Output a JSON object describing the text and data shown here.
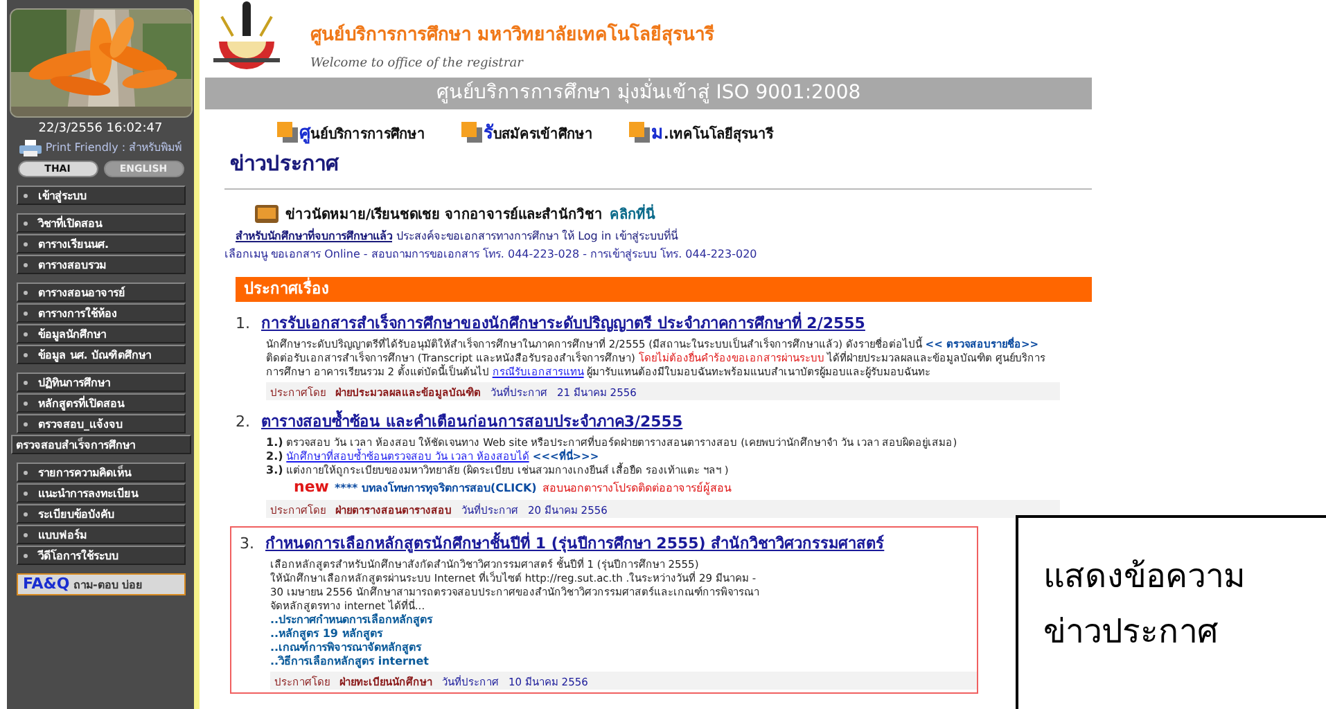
{
  "sidebar": {
    "date": "22/3/2556 16:02:47",
    "print_label": "Print Friendly : สำหรับพิมพ์",
    "languages": [
      {
        "label": "THAI",
        "selected": true
      },
      {
        "label": "ENGLISH",
        "selected": false
      }
    ],
    "menu_groups": [
      [
        {
          "label": "เข้าสู่ระบบ",
          "kind": "bullet"
        }
      ],
      [
        {
          "label": "วิชาที่เปิดสอน",
          "kind": "bullet"
        },
        {
          "label": "ตารางเรียนนศ.",
          "kind": "bullet"
        },
        {
          "label": "ตารางสอบรวม",
          "kind": "bullet"
        }
      ],
      [
        {
          "label": "ตารางสอนอาจารย์",
          "kind": "bullet"
        },
        {
          "label": "ตารางการใช้ห้อง",
          "kind": "bullet"
        },
        {
          "label": "ข้อมูลนักศึกษา",
          "kind": "bullet"
        },
        {
          "label": "ข้อมูล นศ. บัณฑิตศึกษา",
          "kind": "bullet"
        }
      ],
      [
        {
          "label": "ปฏิทินการศึกษา",
          "kind": "bullet"
        },
        {
          "label": "หลักสูตรที่เปิดสอน",
          "kind": "bullet"
        },
        {
          "label": "ตรวจสอบ_แจ้งจบ",
          "kind": "bullet"
        },
        {
          "label": "ตรวจสอบสำเร็จการศึกษา",
          "kind": "wide"
        }
      ],
      [
        {
          "label": "รายการความคิดเห็น",
          "kind": "bullet"
        },
        {
          "label": "แนะนำการลงทะเบียน",
          "kind": "bullet"
        },
        {
          "label": "ระเบียบข้อบังคับ",
          "kind": "bullet"
        },
        {
          "label": "แบบฟอร์ม",
          "kind": "bullet"
        },
        {
          "label": "วีดีโอการใช้ระบบ",
          "kind": "bullet"
        }
      ]
    ],
    "faq": {
      "mark": "FA&Q",
      "text": "ถาม-ตอบ บ่อย"
    }
  },
  "header": {
    "subtitle": "ศูนย์บริการการศึกษา  มหาวิทยาลัยเทคโนโลยีสุรนารี",
    "welcome": "Welcome to office of the registrar",
    "banner": "ศูนย์บริการการศึกษา มุ่งมั่นเข้าสู่ ISO 9001:2008"
  },
  "top_links": [
    {
      "initial": "ศู",
      "rest": "นย์บริการการศึกษา"
    },
    {
      "initial": "รั",
      "rest": "บสมัครเข้าศึกษา"
    },
    {
      "initial": "ม",
      "rest": ".เทคโนโลยีสุรนารี"
    }
  ],
  "page_heading": "ข่าวประกาศ",
  "notice": {
    "text": "ข่าวนัดหมาย/เรียนชดเชย จากอาจารย์และสำนักวิชา",
    "link": "คลิกที่นี่"
  },
  "graduate_line": {
    "link": "สำหรับนักศึกษาที่จบการศึกษาแล้ว",
    "text": "ประสงค์จะขอเอกสารทางการศึกษา ให้ Log in เข้าสู่ระบบที่นี่"
  },
  "contact_line": "เลือกเมนู ขอเอกสาร Online - สอบถามการขอเอกสาร โทร. 044-223-028 - การเข้าสู่ระบบ โทร. 044-223-020",
  "announcements_header": "ประกาศเรื่อง",
  "announcements": [
    {
      "number": "1.",
      "title": "การรับเอกสารสำเร็จการศึกษาของนักศึกษาระดับปริญญาตรี ประจำภาคการศึกษาที่ 2/2555",
      "highlighted": false,
      "blocks": [
        {
          "kind": "para",
          "segments": [
            {
              "kind": "text",
              "text": "นักศึกษาระดับปริญญาตรีที่ได้รับอนุมัติให้สำเร็จการศึกษาในภาคการศึกษาที่ 2/2555 (มีสถานะในระบบเป็นสำเร็จการศึกษาแล้ว) ดังรายชื่อต่อไปนี้ "
            },
            {
              "kind": "strong-link",
              "text": "<< ตรวจสอบรายชื่อ>>"
            },
            {
              "kind": "text",
              "text": " ติดต่อรับเอกสารสำเร็จการศึกษา (Transcript และหนังสือรับรองสำเร็จการศึกษา) "
            },
            {
              "kind": "alert",
              "text": "โดยไม่ต้องยื่นคำร้องขอเอกสารผ่านระบบ"
            },
            {
              "kind": "text",
              "text": " ได้ที่ฝ่ายประมวลผลและข้อมูลบัณฑิต ศูนย์บริการการศึกษา อาคารเรียนรวม 2 ตั้งแต่บัดนี้เป็นต้นไป "
            },
            {
              "kind": "link",
              "text": "กรณีรับเอกสารแทน"
            },
            {
              "kind": "text",
              "text": " ผู้มารับแทนต้องมีใบมอบฉันทะพร้อมแนบสำเนาบัตรผู้มอบและผู้รับมอบฉันทะ"
            }
          ]
        }
      ],
      "posted_label": "ประกาศโดย",
      "posted_by": "ฝ่ายประมวลผลและข้อมูลบัณฑิต",
      "date_label": "วันที่ประกาศ",
      "date": "21 มีนาคม 2556"
    },
    {
      "number": "2.",
      "title": "ตารางสอบซ้ำซ้อน และคำเตือนก่อนการสอบประจำภาค3/2555",
      "highlighted": false,
      "blocks": [
        {
          "kind": "item",
          "num": "1.)",
          "segments": [
            {
              "kind": "text",
              "text": "ตรวจสอบ วัน เวลา ห้องสอบ ให้ชัดเจนทาง Web site หรือประกาศที่บอร์ดฝ่ายตารางสอนตารางสอบ (เคยพบว่านักศึกษาจำ วัน เวลา สอบผิดอยู่เสมอ)"
            }
          ]
        },
        {
          "kind": "item",
          "num": "2.)",
          "segments": [
            {
              "kind": "link",
              "text": "นักศึกษาที่สอบซ้ำซ้อนตรวจสอบ วัน เวลา ห้องสอบได้"
            },
            {
              "kind": "strong-link",
              "text": " <<<ที่นี่>>>"
            }
          ]
        },
        {
          "kind": "item",
          "num": "3.)",
          "segments": [
            {
              "kind": "text",
              "text": "แต่งกายให้ถูกระเบียบของมหาวิทยาลัย (ผิดระเบียบ เช่นสวมกางเกงยีนส์ เสื้อยืด รองเท้าแตะ ฯลฯ )"
            }
          ]
        },
        {
          "kind": "new",
          "badge": "new",
          "segments": [
            {
              "kind": "strong-link",
              "text": "**** บทลงโทษการทุจริตการสอบ(CLICK)"
            },
            {
              "kind": "alert",
              "text": " สอบนอกตารางโปรดติดต่ออาจารย์ผู้สอน"
            }
          ]
        }
      ],
      "posted_label": "ประกาศโดย",
      "posted_by": "ฝ่ายตารางสอนตารางสอบ",
      "date_label": "วันที่ประกาศ",
      "date": "20 มีนาคม 2556"
    },
    {
      "number": "3.",
      "title": "กำหนดการเลือกหลักสูตรนักศึกษาชั้นปีที่ 1 (รุ่นปีการศึกษา 2555) สำนักวิชาวิศวกรรมศาสตร์",
      "highlighted": true,
      "blocks": [
        {
          "kind": "line",
          "text": "เลือกหลักสูตรสำหรับนักศึกษาสังกัดสำนักวิชาวิศวกรรมศาสตร์ ชั้นปีที่ 1 (รุ่นปีการศึกษา 2555)"
        },
        {
          "kind": "line",
          "text": "ให้นักศึกษาเลือกหลักสูตรผ่านระบบ Internet ที่เว็บไซต์ http://reg.sut.ac.th .ในระหว่างวันที่ 29 มีนาคม -"
        },
        {
          "kind": "line",
          "text": "30 เมษายน 2556 นักศึกษาสามารถตรวจสอบประกาศของสำนักวิชาวิศวกรรมศาสตร์และเกณฑ์การพิจารณา"
        },
        {
          "kind": "line",
          "text": "จัดหลักสูตรทาง internet ได้ที่นี่..."
        },
        {
          "kind": "link",
          "text": "..ประกาศกำหนดการเลือกหลักสูตร"
        },
        {
          "kind": "link",
          "text": "..หลักสูตร 19 หลักสูตร"
        },
        {
          "kind": "link",
          "text": "..เกณฑ์การพิจารณาจัดหลักสูตร"
        },
        {
          "kind": "link",
          "text": "..วิธีการเลือกหลักสูตร internet"
        }
      ],
      "posted_label": "ประกาศโดย",
      "posted_by": "ฝ่ายทะเบียนนักศึกษา",
      "date_label": "วันที่ประกาศ",
      "date": "10 มีนาคม 2556"
    }
  ],
  "callout": {
    "lines": [
      "แสดงข้อความ",
      "ข่าวประกาศ"
    ]
  }
}
